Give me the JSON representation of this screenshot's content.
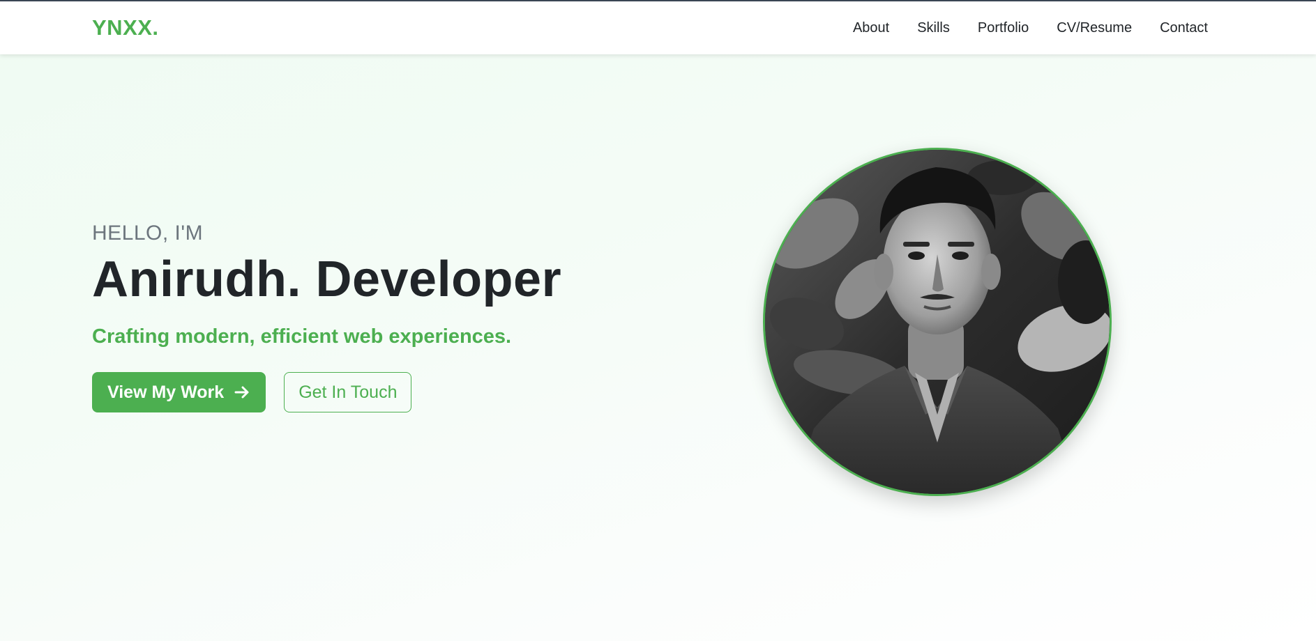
{
  "logo": "YNXX.",
  "nav": [
    "About",
    "Skills",
    "Portfolio",
    "CV/Resume",
    "Contact"
  ],
  "hero": {
    "greeting": "HELLO, I'M",
    "name": "Anirudh. Developer",
    "tagline": "Crafting modern, efficient web experiences.",
    "primary_button": "View My Work",
    "secondary_button": "Get In Touch"
  },
  "colors": {
    "accent": "#4caf50",
    "text_dark": "#212529",
    "text_muted": "#6c757d"
  },
  "icons": {
    "primary_button_icon": "arrow-right-icon"
  }
}
